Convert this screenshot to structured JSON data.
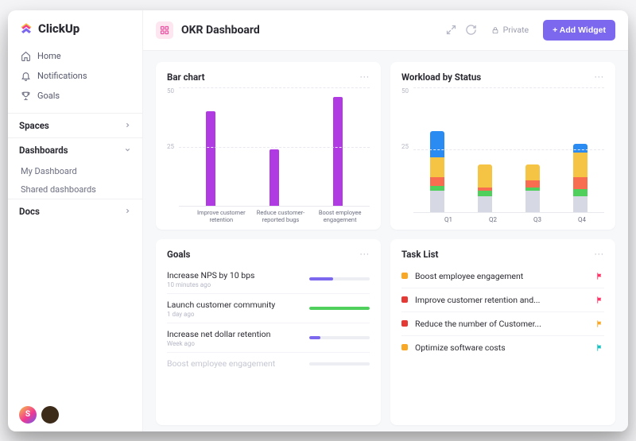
{
  "brand": "ClickUp",
  "nav": {
    "home": "Home",
    "notifications": "Notifications",
    "goals": "Goals"
  },
  "sections": {
    "spaces": "Spaces",
    "dashboards": "Dashboards",
    "docs": "Docs"
  },
  "dashboards_children": {
    "my": "My Dashboard",
    "shared": "Shared dashboards"
  },
  "avatar_initial": "S",
  "header": {
    "title": "OKR Dashboard",
    "private": "Private",
    "add_widget": "+ Add Widget"
  },
  "cards": {
    "bar_chart_title": "Bar chart",
    "workload_title": "Workload by Status",
    "goals_title": "Goals",
    "tasks_title": "Task List"
  },
  "goals": [
    {
      "name": "Increase NPS by 10 bps",
      "time": "10 minutes ago",
      "progress": 40,
      "color": "#7b68ee"
    },
    {
      "name": "Launch customer community",
      "time": "1 day ago",
      "progress": 100,
      "color": "#4fcf5b"
    },
    {
      "name": "Increase net dollar retention",
      "time": "Week ago",
      "progress": 18,
      "color": "#7b68ee"
    },
    {
      "name": "Boost employee engagement",
      "time": "",
      "progress": 0,
      "color": "#7b68ee",
      "faded": true
    }
  ],
  "tasks": [
    {
      "name": "Boost employee engagement",
      "dot": "#f9a825",
      "flag": "#f36"
    },
    {
      "name": "Improve customer retention and...",
      "dot": "#e53935",
      "flag": "#f36"
    },
    {
      "name": "Reduce the number of Customer...",
      "dot": "#e53935",
      "flag": "#f9a825"
    },
    {
      "name": "Optimize software costs",
      "dot": "#f9a825",
      "flag": "#19c2c2"
    }
  ],
  "colors": {
    "purple": "#b03be3",
    "s_gray": "#d6d8e4",
    "s_green": "#4fcf5b",
    "s_orange": "#f86c4f",
    "s_yellow": "#f6c445",
    "s_blue": "#2a8cf2"
  },
  "chart_data": [
    {
      "type": "bar",
      "title": "Bar chart",
      "ylim": [
        0,
        50
      ],
      "yticks": [
        25,
        50
      ],
      "categories": [
        "Improve customer retention",
        "Reduce customer-reported bugs",
        "Boost employee engagement"
      ],
      "values": [
        40,
        24,
        46
      ]
    },
    {
      "type": "bar",
      "stacked": true,
      "title": "Workload by Status",
      "ylim": [
        0,
        50
      ],
      "yticks": [
        25,
        50
      ],
      "categories": [
        "Q1",
        "Q2",
        "Q3",
        "Q4"
      ],
      "series": [
        {
          "name": "gray",
          "color": "#d6d8e4",
          "values": [
            12,
            9,
            12,
            9
          ]
        },
        {
          "name": "green",
          "color": "#4fcf5b",
          "values": [
            3,
            3,
            2,
            4
          ]
        },
        {
          "name": "orange",
          "color": "#f86c4f",
          "values": [
            5,
            2,
            4,
            7
          ]
        },
        {
          "name": "yellow",
          "color": "#f6c445",
          "values": [
            11,
            13,
            9,
            14
          ]
        },
        {
          "name": "blue",
          "color": "#2a8cf2",
          "values": [
            15,
            0,
            0,
            5
          ]
        }
      ]
    }
  ]
}
